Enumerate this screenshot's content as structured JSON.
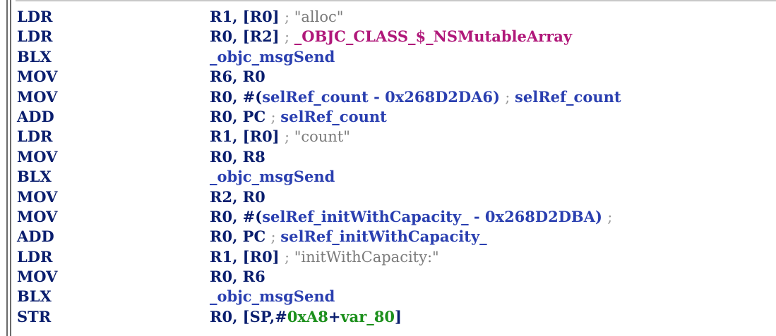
{
  "colors": {
    "mnemonic": "#0a1e6e",
    "register": "#0a1e6e",
    "symbol": "#2a3fb0",
    "class_ref": "#b0187a",
    "comment": "#9a9a9a",
    "string": "#7a7a7a",
    "number": "#1b8f1b",
    "background": "#ffffff"
  },
  "lines": [
    {
      "mnemonic": "LDR",
      "tokens": [
        {
          "t": "R1, [R0] ",
          "k": "plain"
        },
        {
          "t": "; ",
          "k": "comment"
        },
        {
          "t": "\"alloc\"",
          "k": "string"
        }
      ]
    },
    {
      "mnemonic": "LDR",
      "tokens": [
        {
          "t": "R0, [R2] ",
          "k": "plain"
        },
        {
          "t": "; ",
          "k": "comment"
        },
        {
          "t": "_OBJC_CLASS_$_NSMutableArray",
          "k": "class"
        }
      ]
    },
    {
      "mnemonic": "BLX",
      "tokens": [
        {
          "t": "_objc_msgSend",
          "k": "name"
        }
      ]
    },
    {
      "mnemonic": "MOV",
      "tokens": [
        {
          "t": "R6, R0",
          "k": "plain"
        }
      ]
    },
    {
      "mnemonic": "MOV",
      "tokens": [
        {
          "t": "R0, #(",
          "k": "plain"
        },
        {
          "t": "selRef_count",
          "k": "name"
        },
        {
          "t": " - 0x268D2DA6) ",
          "k": "name"
        },
        {
          "t": "; ",
          "k": "comment"
        },
        {
          "t": "selRef_count",
          "k": "name"
        }
      ]
    },
    {
      "mnemonic": "ADD",
      "tokens": [
        {
          "t": "R0, PC ",
          "k": "plain"
        },
        {
          "t": "; ",
          "k": "comment"
        },
        {
          "t": "selRef_count",
          "k": "name"
        }
      ]
    },
    {
      "mnemonic": "LDR",
      "tokens": [
        {
          "t": "R1, [R0] ",
          "k": "plain"
        },
        {
          "t": "; ",
          "k": "comment"
        },
        {
          "t": "\"count\"",
          "k": "string"
        }
      ]
    },
    {
      "mnemonic": "MOV",
      "tokens": [
        {
          "t": "R0, R8",
          "k": "plain"
        }
      ]
    },
    {
      "mnemonic": "BLX",
      "tokens": [
        {
          "t": "_objc_msgSend",
          "k": "name"
        }
      ]
    },
    {
      "mnemonic": "MOV",
      "tokens": [
        {
          "t": "R2, R0",
          "k": "plain"
        }
      ]
    },
    {
      "mnemonic": "MOV",
      "tokens": [
        {
          "t": "R0, #(",
          "k": "plain"
        },
        {
          "t": "selRef_initWithCapacity_",
          "k": "name"
        },
        {
          "t": " - 0x268D2DBA) ",
          "k": "name"
        },
        {
          "t": ";",
          "k": "comment"
        }
      ]
    },
    {
      "mnemonic": "ADD",
      "tokens": [
        {
          "t": "R0, PC ",
          "k": "plain"
        },
        {
          "t": "; ",
          "k": "comment"
        },
        {
          "t": "selRef_initWithCapacity_",
          "k": "name"
        }
      ]
    },
    {
      "mnemonic": "LDR",
      "tokens": [
        {
          "t": "R1, [R0] ",
          "k": "plain"
        },
        {
          "t": "; ",
          "k": "comment"
        },
        {
          "t": "\"initWithCapacity:\"",
          "k": "string"
        }
      ]
    },
    {
      "mnemonic": "MOV",
      "tokens": [
        {
          "t": "R0, R6",
          "k": "plain"
        }
      ]
    },
    {
      "mnemonic": "BLX",
      "tokens": [
        {
          "t": "_objc_msgSend",
          "k": "name"
        }
      ]
    },
    {
      "mnemonic": "STR",
      "tokens": [
        {
          "t": "R0, [SP,#",
          "k": "plain"
        },
        {
          "t": "0xA8",
          "k": "num"
        },
        {
          "t": "+",
          "k": "plain"
        },
        {
          "t": "var_80",
          "k": "num"
        },
        {
          "t": "]",
          "k": "plain"
        }
      ]
    }
  ]
}
